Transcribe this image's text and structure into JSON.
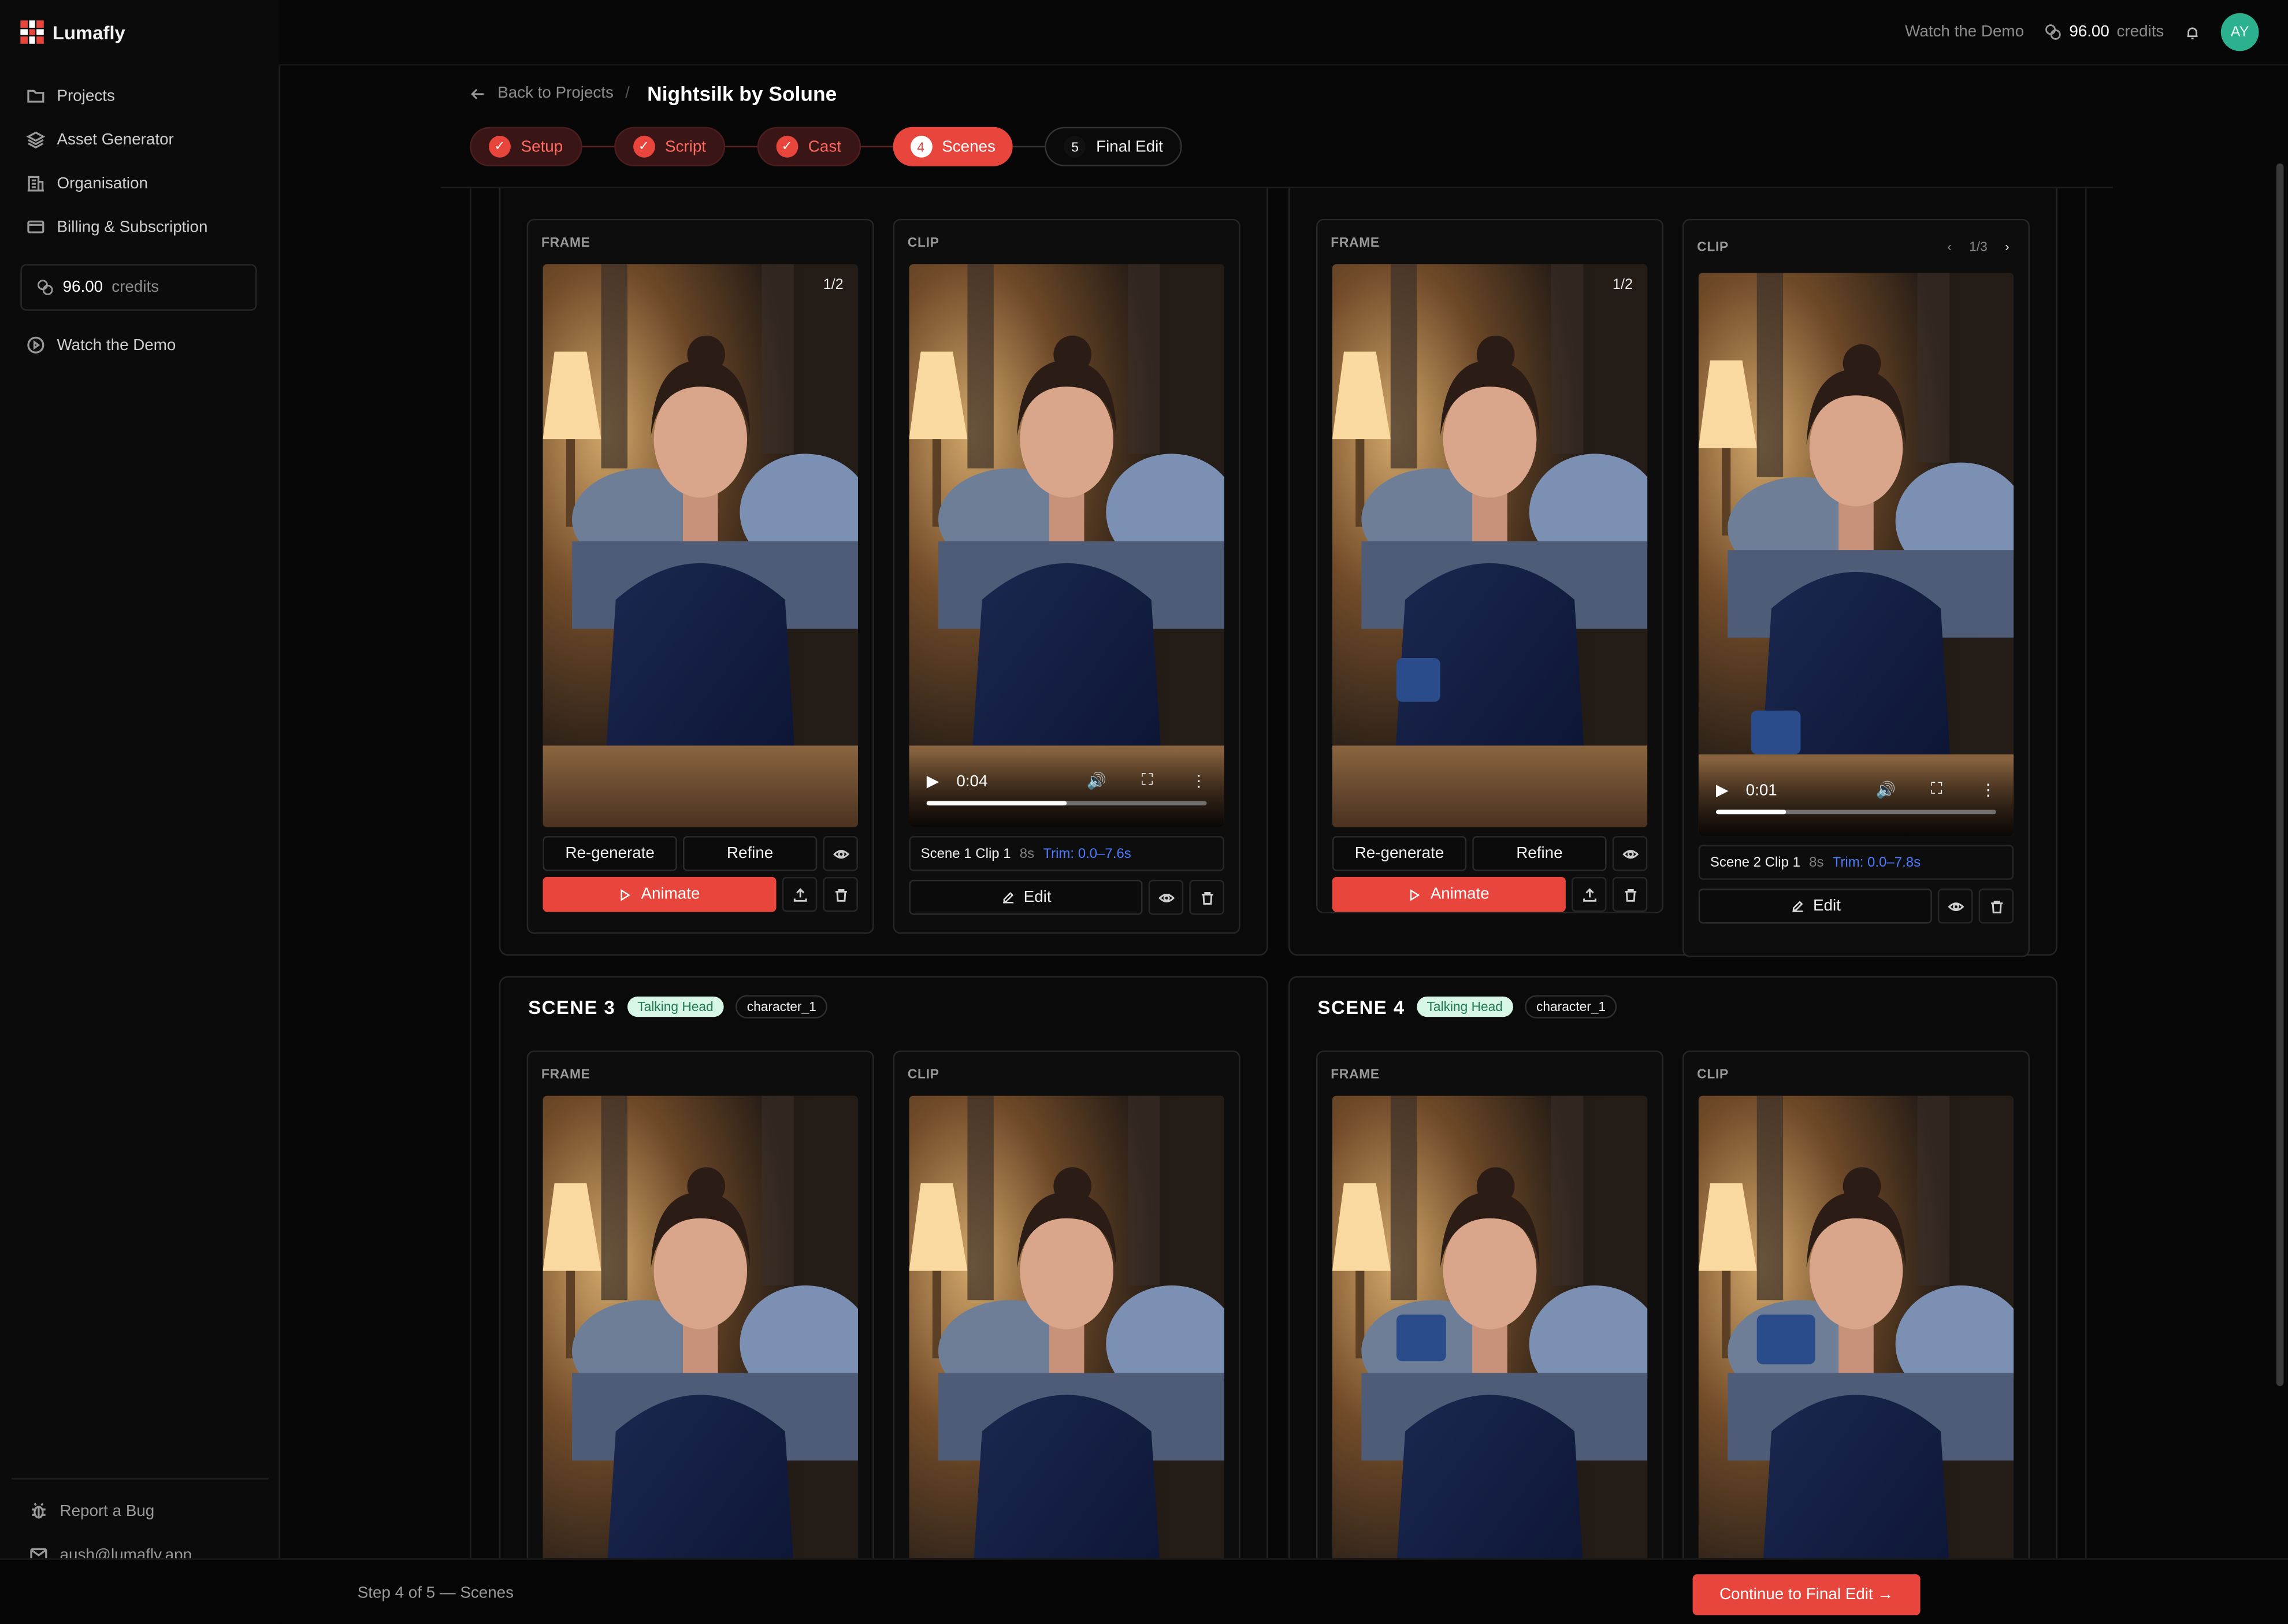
{
  "app": {
    "name": "Lumafly"
  },
  "sidebar": {
    "items": [
      {
        "label": "Projects",
        "icon": "folder-icon"
      },
      {
        "label": "Asset Generator",
        "icon": "layers-icon"
      },
      {
        "label": "Organisation",
        "icon": "building-icon"
      },
      {
        "label": "Billing & Subscription",
        "icon": "card-icon"
      }
    ],
    "credits_value": "96.00",
    "credits_unit": "credits",
    "watch_demo": "Watch the Demo",
    "report_bug": "Report a Bug",
    "email": "aush@lumafly.app"
  },
  "topbar": {
    "watch_demo": "Watch the Demo",
    "credits_value": "96.00",
    "credits_unit": "credits",
    "avatar_initials": "AY"
  },
  "header": {
    "back": "Back to Projects",
    "separator": "/",
    "project_title": "Nightsilk by Solune"
  },
  "steps": [
    {
      "label": "Setup",
      "state": "done",
      "marker": "✓"
    },
    {
      "label": "Script",
      "state": "done",
      "marker": "✓"
    },
    {
      "label": "Cast",
      "state": "done",
      "marker": "✓"
    },
    {
      "label": "Scenes",
      "state": "active",
      "marker": "4"
    },
    {
      "label": "Final Edit",
      "state": "todo",
      "marker": "5"
    }
  ],
  "labels": {
    "frame": "FRAME",
    "clip": "CLIP",
    "regenerate": "Re-generate",
    "refine": "Refine",
    "animate": "Animate",
    "edit": "Edit"
  },
  "scenes": [
    {
      "frame_counter": "1/2",
      "clip": {
        "time": "0:04",
        "progress": 0.5,
        "name": "Scene 1 Clip 1",
        "duration": "8s",
        "trim": "Trim: 0.0–7.6s"
      }
    },
    {
      "frame_counter": "1/2",
      "clip": {
        "counter": "1/3",
        "time": "0:01",
        "progress": 0.25,
        "name": "Scene 2 Clip 1",
        "duration": "8s",
        "trim": "Trim: 0.0–7.8s"
      }
    },
    {
      "title": "SCENE 3",
      "type": "Talking Head",
      "character": "character_1"
    },
    {
      "title": "SCENE 4",
      "type": "Talking Head",
      "character": "character_1"
    }
  ],
  "footer": {
    "step_text": "Step 4 of 5 — Scenes",
    "continue": "Continue to Final Edit →"
  },
  "colors": {
    "accent": "#e8453c",
    "trim": "#4b7bff",
    "talking_head": "#d8f6e6",
    "avatar": "#2bb18d"
  }
}
